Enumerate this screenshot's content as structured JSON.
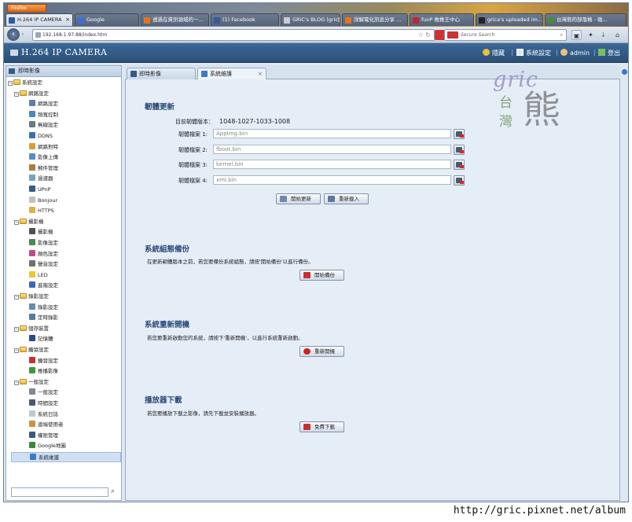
{
  "browser": {
    "menu_button": "Firefox",
    "tabs": [
      {
        "label": "H.264 IP CAMERA",
        "active": true,
        "color": "#2c5aa0"
      },
      {
        "label": "Google",
        "active": false,
        "color": "#3a6fd8"
      },
      {
        "label": "透過在資訊領域的一...",
        "active": false,
        "color": "#e8731c"
      },
      {
        "label": "(1) Facebook",
        "active": false,
        "color": "#3b5998"
      },
      {
        "label": "GRiC's BLOG (gric創...",
        "active": false,
        "color": "#cccccc"
      },
      {
        "label": "詳解電化訊息分享 ...",
        "active": false,
        "color": "#e8731c"
      },
      {
        "label": "funP 推推王中心",
        "active": false,
        "color": "#c8202e"
      },
      {
        "label": "grica's uploaded im...",
        "active": false,
        "color": "#222222"
      },
      {
        "label": "台灣熊的部落格 - 微...",
        "active": false,
        "color": "#4a8a3a"
      }
    ],
    "url": "192.168.1.97:88/index.htm",
    "search_placeholder": "Secure Search"
  },
  "app": {
    "title": "H.264 IP CAMERA",
    "menu": {
      "bookmark": "隱藏",
      "system": "系統設定",
      "user": "admin",
      "logout": "登出"
    }
  },
  "sidebar": {
    "header": "即時影像",
    "tree": [
      {
        "label": "系統設定",
        "level": 0,
        "type": "folder",
        "expandable": true
      },
      {
        "label": "網路設定",
        "level": 1,
        "type": "folder",
        "expandable": true
      },
      {
        "label": "網路設定",
        "level": 2,
        "type": "item",
        "icon": "#5c7fa8"
      },
      {
        "label": "頻寬控制",
        "level": 2,
        "type": "item",
        "icon": "#4a88c8"
      },
      {
        "label": "無線設定",
        "level": 2,
        "type": "item",
        "icon": "#707880"
      },
      {
        "label": "DDNS",
        "level": 2,
        "type": "item",
        "icon": "#3a70b0"
      },
      {
        "label": "網路對時",
        "level": 2,
        "type": "item",
        "icon": "#d8a030"
      },
      {
        "label": "影像上傳",
        "level": 2,
        "type": "item",
        "icon": "#5a8ac8"
      },
      {
        "label": "郵件管理",
        "level": 2,
        "type": "item",
        "icon": "#b07a40"
      },
      {
        "label": "過濾器",
        "level": 2,
        "type": "item",
        "icon": "#7aa0c0"
      },
      {
        "label": "UPnP",
        "level": 2,
        "type": "item",
        "icon": "#3a5a8a"
      },
      {
        "label": "Bonjour",
        "level": 2,
        "type": "item",
        "icon": "#c0c0c0"
      },
      {
        "label": "HTTPS",
        "level": 2,
        "type": "item",
        "icon": "#e0b040"
      },
      {
        "label": "攝影機",
        "level": 1,
        "type": "folder",
        "expandable": true
      },
      {
        "label": "攝影機",
        "level": 2,
        "type": "item",
        "icon": "#505050"
      },
      {
        "label": "影像設定",
        "level": 2,
        "type": "item",
        "icon": "#4a8a4a"
      },
      {
        "label": "顏色設定",
        "level": 2,
        "type": "item",
        "icon": "#c04a8a"
      },
      {
        "label": "聲音設定",
        "level": 2,
        "type": "item",
        "icon": "#707070"
      },
      {
        "label": "LED",
        "level": 2,
        "type": "item",
        "icon": "#e8c830"
      },
      {
        "label": "進階設定",
        "level": 2,
        "type": "item",
        "icon": "#3a6ab0"
      },
      {
        "label": "錄影設定",
        "level": 1,
        "type": "folder",
        "expandable": true
      },
      {
        "label": "錄影設定",
        "level": 2,
        "type": "item",
        "icon": "#6a8ab0"
      },
      {
        "label": "定時錄影",
        "level": 2,
        "type": "item",
        "icon": "#5a7aa0"
      },
      {
        "label": "儲存裝置",
        "level": 1,
        "type": "folder",
        "expandable": true
      },
      {
        "label": "記憶體",
        "level": 2,
        "type": "item",
        "icon": "#2a4a8a"
      },
      {
        "label": "觸發設定",
        "level": 1,
        "type": "folder",
        "expandable": true
      },
      {
        "label": "觸發設定",
        "level": 2,
        "type": "item",
        "icon": "#c83030"
      },
      {
        "label": "推播影像",
        "level": 2,
        "type": "item",
        "icon": "#3a9a3a"
      },
      {
        "label": "一般設定",
        "level": 1,
        "type": "folder",
        "expandable": true
      },
      {
        "label": "一般設定",
        "level": 2,
        "type": "item",
        "icon": "#808890"
      },
      {
        "label": "時間設定",
        "level": 2,
        "type": "item",
        "icon": "#4a5a70"
      },
      {
        "label": "系統日誌",
        "level": 2,
        "type": "item",
        "icon": "#c0c8d0"
      },
      {
        "label": "遠端使用者",
        "level": 2,
        "type": "item",
        "icon": "#d09040"
      },
      {
        "label": "權限管理",
        "level": 2,
        "type": "item",
        "icon": "#3a5a7a"
      },
      {
        "label": "Google地圖",
        "level": 2,
        "type": "item",
        "icon": "#3a8a3a"
      },
      {
        "label": "系統維護",
        "level": 2,
        "type": "item",
        "icon": "#3a7ac8",
        "selected": true
      }
    ]
  },
  "tabs": [
    {
      "label": "即時影像",
      "active": false
    },
    {
      "label": "系統維護",
      "active": true
    }
  ],
  "firmware": {
    "title": "韌體更新",
    "version_label": "目前韌體版本：",
    "version_value": "1048-1027-1033-1008",
    "files": [
      {
        "label": "韌體檔案 1:",
        "value": "AppImg.bin"
      },
      {
        "label": "韌體檔案 2:",
        "value": "fboot.bin"
      },
      {
        "label": "韌體檔案 3:",
        "value": "kernel.bin"
      },
      {
        "label": "韌體檔案 4:",
        "value": "xml.bin"
      }
    ],
    "start_button": "開始更新",
    "reload_button": "重新載入"
  },
  "backup": {
    "title": "系統組態備份",
    "desc": "在更新韌體版本之前，若您要備份系統組態，請按'開始備份'以進行備份。",
    "button": "開始備份"
  },
  "reboot": {
    "title": "系統重新開機",
    "desc": "若您要重新啟動您的系統，請按下'重新開機'，以進行系統重新啟動。",
    "button": "重新開機"
  },
  "player": {
    "title": "播放器下載",
    "desc": "若您要播放下載之影像，請先下載並安裝播放器。",
    "button": "免費下載"
  },
  "watermark": {
    "brand": "gric",
    "line1": "台",
    "line2": "灣",
    "big": "熊",
    "footer_url": "http://gric.pixnet.net/album"
  }
}
